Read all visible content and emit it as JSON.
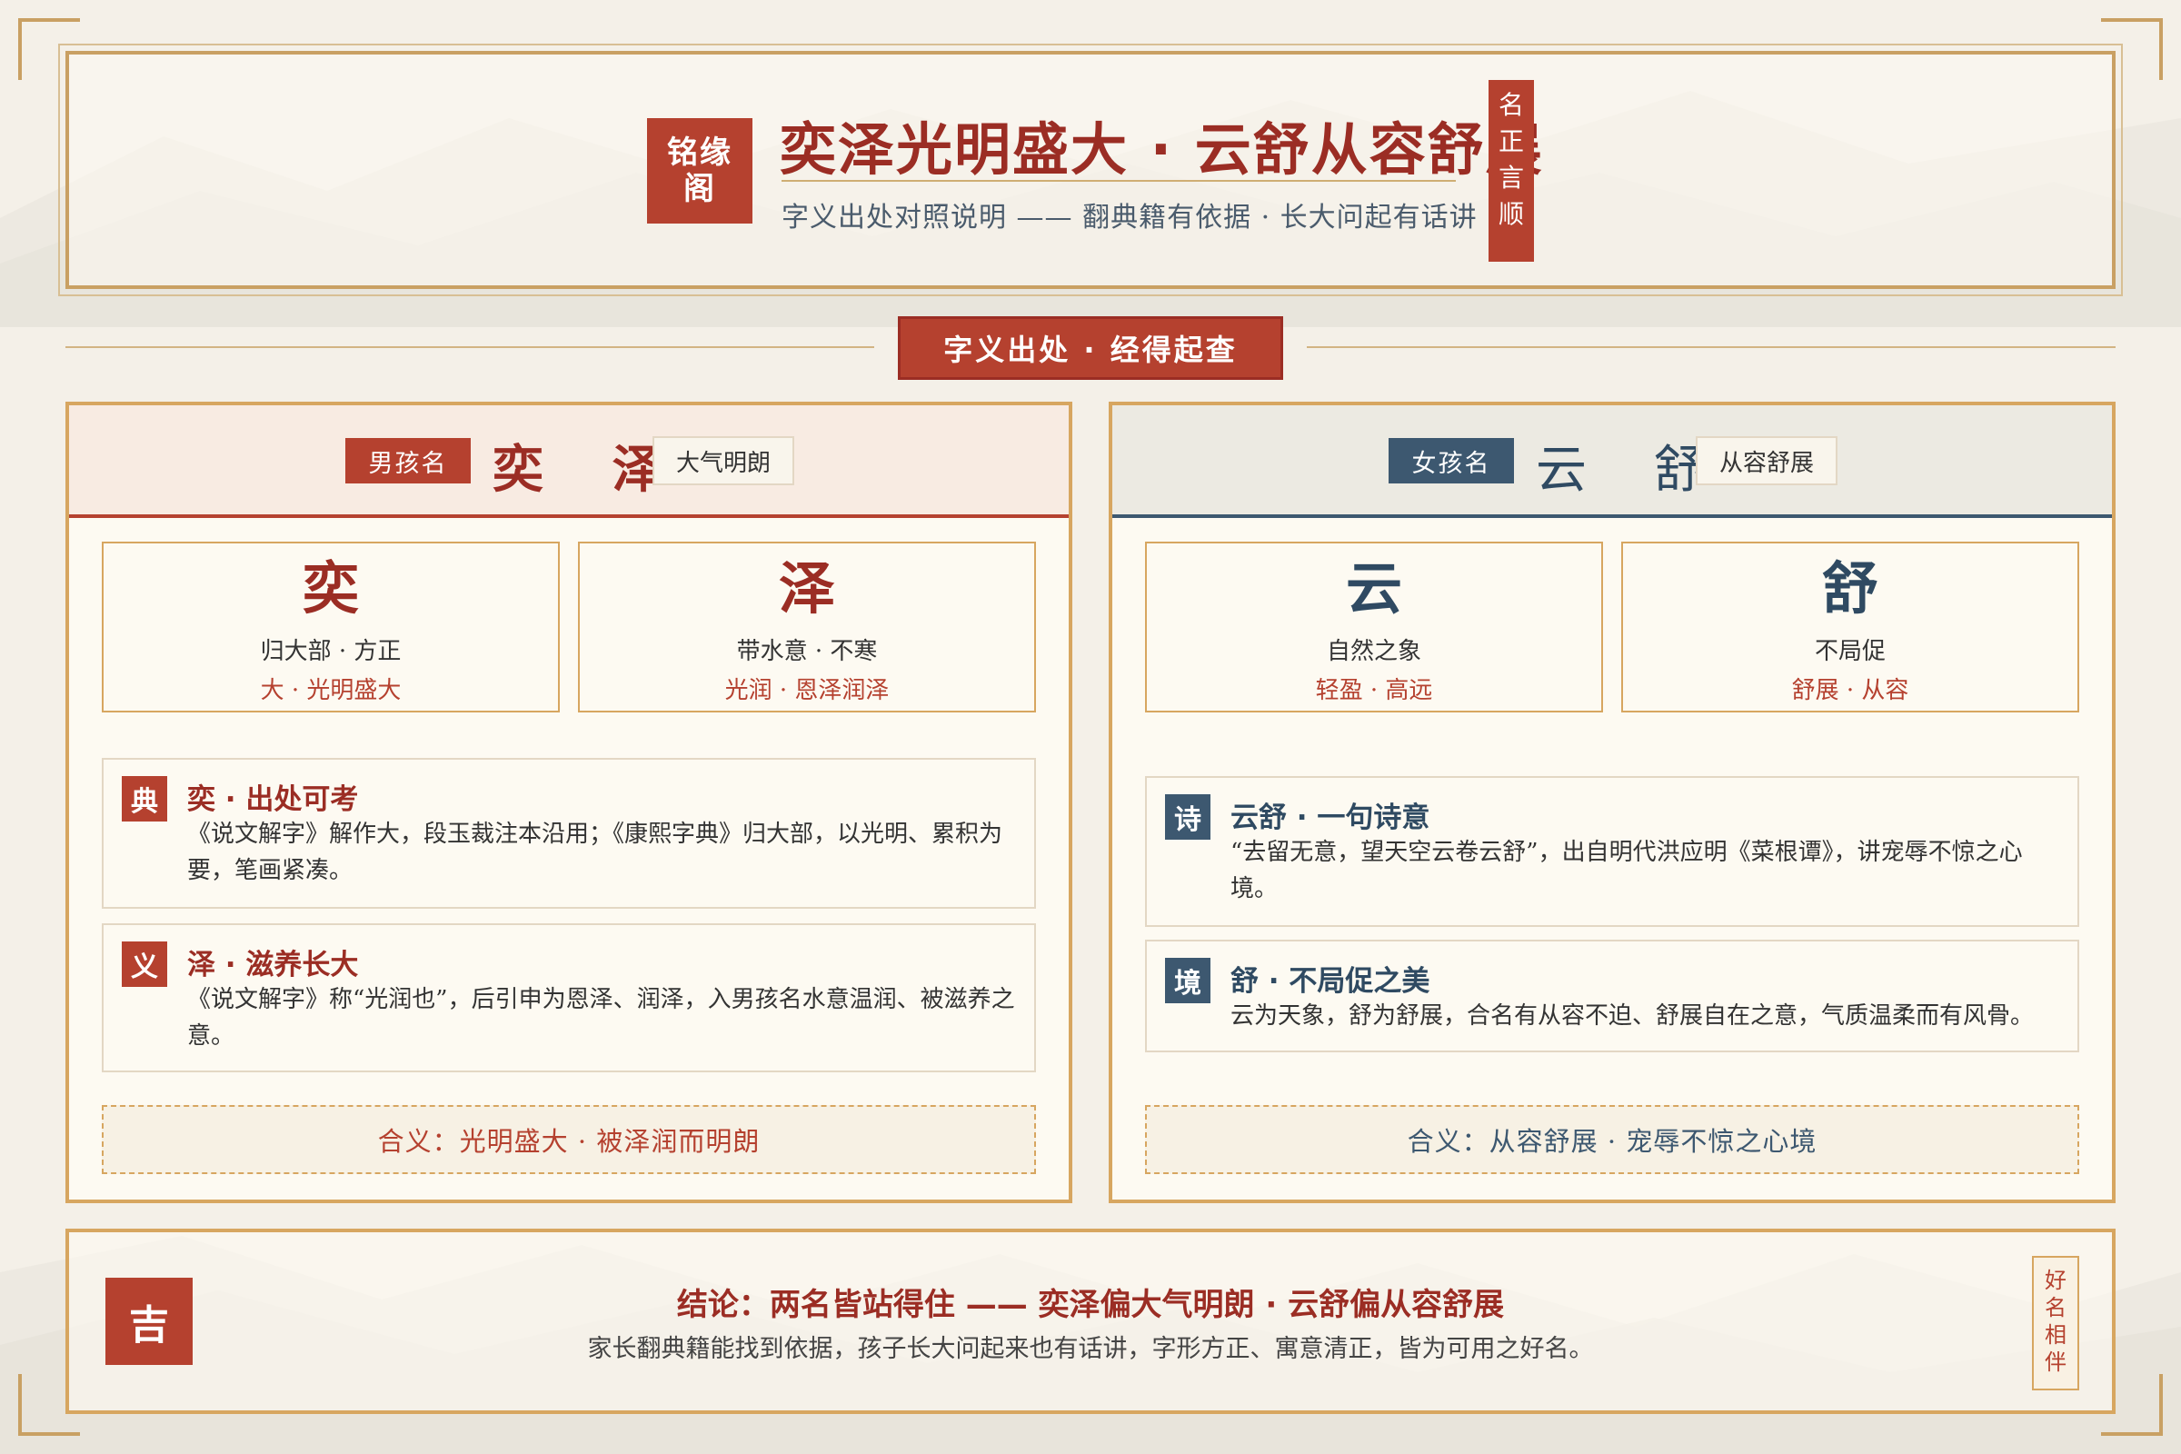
{
  "colors": {
    "background": "#f4f0e8",
    "red": "#b5412f",
    "dark_red": "#9b2d24",
    "blue": "#3d5870",
    "gold": "#c9a063"
  },
  "header": {
    "seal_text": "铭缘阁",
    "title": "奕泽光明盛大 · 云舒从容舒展",
    "subtitle": "字义出处对照说明 —— 翻典籍有依据 · 长大问起有话讲",
    "vertical_seal": "名正言顺"
  },
  "banner": {
    "label": "字义出处 · 经得起查"
  },
  "boy": {
    "tag": "男孩名",
    "name": "奕 泽",
    "desc": "大气明朗",
    "chars": [
      {
        "char": "奕",
        "line1": "归大部 · 方正",
        "line2": "大 · 光明盛大"
      },
      {
        "char": "泽",
        "line1": "带水意 · 不寒",
        "line2": "光润 · 恩泽润泽"
      }
    ],
    "notes": [
      {
        "badge": "典",
        "title": "奕 · 出处可考",
        "body": "《说文解字》解作大，段玉裁注本沿用；《康熙字典》归大部，以光明、累积为要，笔画紧凑。"
      },
      {
        "badge": "义",
        "title": "泽 · 滋养长大",
        "body": "《说文解字》称“光润也”，后引申为恩泽、润泽，入男孩名水意温润、被滋养之意。"
      }
    ],
    "summary": "合义：光明盛大 · 被泽润而明朗"
  },
  "girl": {
    "tag": "女孩名",
    "name": "云 舒",
    "desc": "从容舒展",
    "chars": [
      {
        "char": "云",
        "line1": "自然之象",
        "line2": "轻盈 · 高远"
      },
      {
        "char": "舒",
        "line1": "不局促",
        "line2": "舒展 · 从容"
      }
    ],
    "notes": [
      {
        "badge": "诗",
        "title": "云舒 · 一句诗意",
        "body": "“去留无意，望天空云卷云舒”，出自明代洪应明《菜根谭》，讲宠辱不惊之心境。"
      },
      {
        "badge": "境",
        "title": "舒 · 不局促之美",
        "body": "云为天象，舒为舒展，合名有从容不迫、舒展自在之意，气质温柔而有风骨。"
      }
    ],
    "summary": "合义：从容舒展 · 宠辱不惊之心境"
  },
  "footer": {
    "ji": "吉",
    "conclusion": "结论：两名皆站得住 —— 奕泽偏大气明朗 · 云舒偏从容舒展",
    "sub": "家长翻典籍能找到依据，孩子长大问起来也有话讲，字形方正、寓意清正，皆为可用之好名。",
    "vertical_stamp": "好名相伴"
  }
}
